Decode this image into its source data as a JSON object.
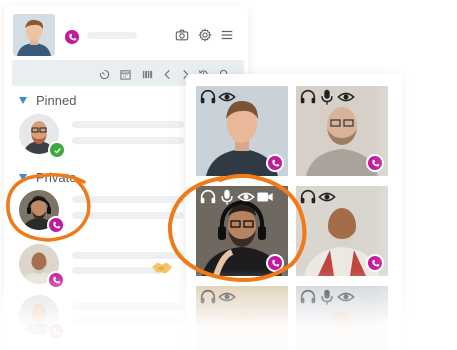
{
  "sections": {
    "pinned": "Pinned",
    "private": "Private"
  },
  "colors": {
    "accent": "#c2199d",
    "highlight_circle": "#f07a17",
    "online": "#3ba93f",
    "section_arrow": "#3f8ad1"
  },
  "icons": {
    "header": [
      "camera-icon",
      "settings-icon",
      "menu-icon"
    ],
    "toolbar": [
      "timer-icon",
      "calendar-icon",
      "barcode-icon",
      "chevron-left-icon",
      "chevron-right-icon",
      "history-icon",
      "search-icon"
    ],
    "tile_controls": [
      "headphones-icon",
      "microphone-icon",
      "eye-icon",
      "video-icon"
    ]
  }
}
